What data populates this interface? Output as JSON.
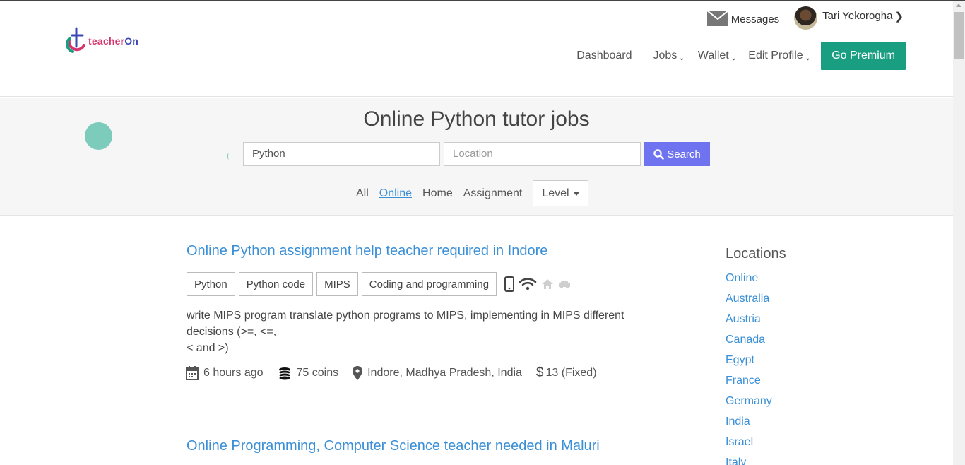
{
  "brand": {
    "prefix": "teacher",
    "suffix": "On"
  },
  "topbar": {
    "messages_label": "Messages",
    "user_name": "Tari Yekorogha"
  },
  "nav": {
    "items": [
      {
        "label": "Dashboard",
        "dropdown": false
      },
      {
        "label": "Jobs",
        "dropdown": true
      },
      {
        "label": "Wallet",
        "dropdown": true
      },
      {
        "label": "Edit Profile",
        "dropdown": true
      }
    ],
    "premium_label": "Go Premium"
  },
  "search": {
    "title": "Online Python tutor jobs",
    "query_value": "Python",
    "location_placeholder": "Location",
    "button_label": "Search"
  },
  "filters": {
    "items": [
      {
        "label": "All",
        "active": false
      },
      {
        "label": "Online",
        "active": true
      },
      {
        "label": "Home",
        "active": false
      },
      {
        "label": "Assignment",
        "active": false
      }
    ],
    "level_label": "Level"
  },
  "jobs": [
    {
      "title": "Online Python assignment help teacher required in Indore",
      "tags": [
        "Python",
        "Python code",
        "MIPS",
        "Coding and programming"
      ],
      "modes": [
        "phone-icon",
        "wifi-icon",
        "home-icon",
        "car-icon"
      ],
      "description_line1": "write MIPS program translate python programs to MIPS, implementing in MIPS different",
      "description_line2": "decisions (>=, <=,",
      "description_line3": "< and >)",
      "posted": "6 hours ago",
      "coins": "75 coins",
      "location": "Indore, Madhya Pradesh, India",
      "price": "13 (Fixed)"
    },
    {
      "title": "Online Programming, Computer Science teacher needed in Maluri"
    }
  ],
  "sidebar": {
    "title": "Locations",
    "locations": [
      "Online",
      "Australia",
      "Austria",
      "Canada",
      "Egypt",
      "France",
      "Germany",
      "India",
      "Israel",
      "Italy"
    ]
  },
  "colors": {
    "accent": "#3a8fd6",
    "premium": "#1a9e82",
    "search_button": "#6f73f0"
  }
}
